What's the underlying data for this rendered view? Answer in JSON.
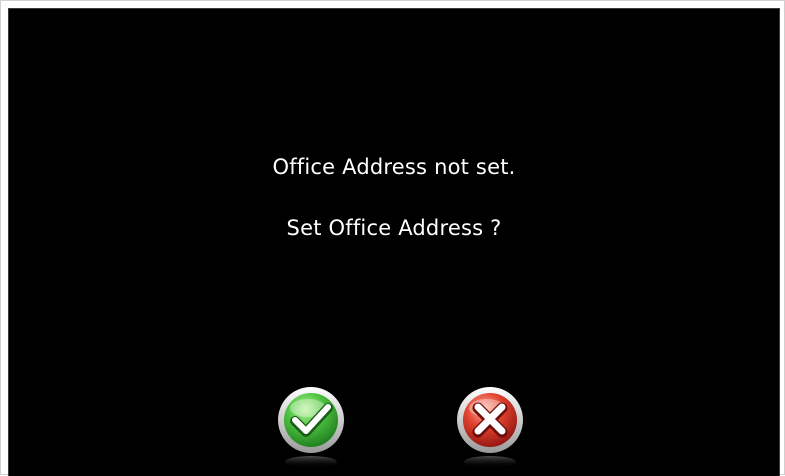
{
  "dialog": {
    "message_line_1": "Office Address not set.",
    "message_line_2": "Set Office Address ?"
  },
  "buttons": {
    "confirm_icon": "checkmark-icon",
    "cancel_icon": "close-icon"
  },
  "colors": {
    "background": "#000000",
    "text": "#ffffff",
    "confirm_green": "#3fb43a",
    "cancel_red": "#d8302a"
  }
}
